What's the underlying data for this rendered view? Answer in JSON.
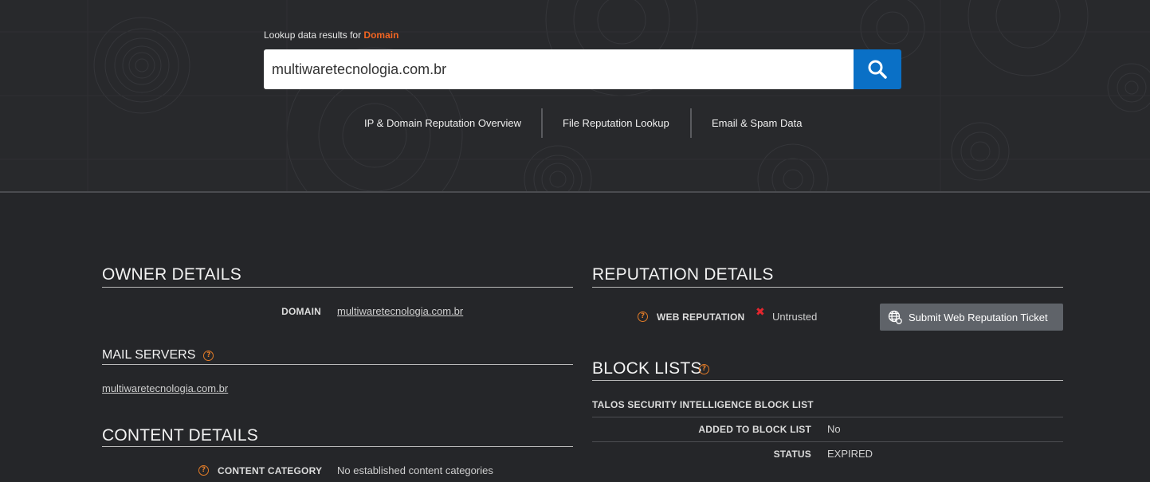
{
  "search": {
    "label_prefix": "Lookup data results for",
    "label_type": "Domain",
    "query": "multiwaretecnologia.com.br"
  },
  "nav": {
    "items": [
      "IP & Domain Reputation Overview",
      "File Reputation Lookup",
      "Email & Spam Data"
    ]
  },
  "owner": {
    "title": "OWNER DETAILS",
    "domain_label": "DOMAIN",
    "domain_value": "multiwaretecnologia.com.br"
  },
  "mail": {
    "title": "MAIL SERVERS",
    "server": "multiwaretecnologia.com.br"
  },
  "content": {
    "title": "CONTENT DETAILS",
    "category_label": "CONTENT CATEGORY",
    "category_value": "No established content categories"
  },
  "reputation": {
    "title": "REPUTATION DETAILS",
    "web_label": "WEB REPUTATION",
    "web_value": "Untrusted",
    "ticket_button": "Submit Web Reputation Ticket"
  },
  "blocklists": {
    "title": "BLOCK LISTS",
    "list_name": "TALOS SECURITY INTELLIGENCE BLOCK LIST",
    "added_label": "ADDED TO BLOCK LIST",
    "added_value": "No",
    "status_label": "STATUS",
    "status_value": "EXPIRED"
  },
  "icons": {
    "search": "search-icon",
    "help": "help-icon",
    "untrusted": "x-mark-icon",
    "globe": "globe-icon"
  },
  "colors": {
    "accent": "#f26522",
    "button_blue": "#0a70c6",
    "untrusted_red": "#e3262e",
    "help_orange": "#e07b28",
    "background": "#252629"
  }
}
